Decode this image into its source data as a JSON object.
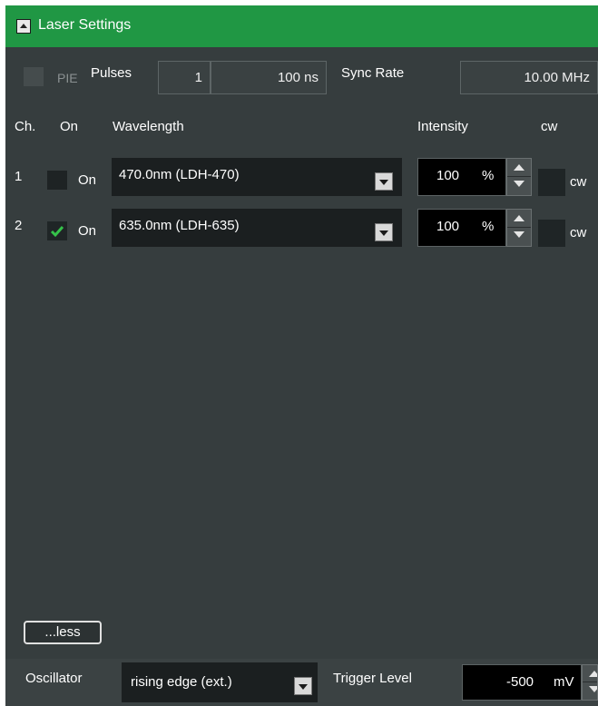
{
  "header": {
    "title": "Laser Settings"
  },
  "top": {
    "pie_label": "PIE",
    "pulses_label": "Pulses",
    "pulses_count": "1",
    "pulse_width": "100 ns",
    "sync_rate_label": "Sync Rate",
    "sync_rate_value": "10.00 MHz"
  },
  "columns": {
    "ch": "Ch.",
    "on": "On",
    "wavelength": "Wavelength",
    "intensity": "Intensity",
    "cw": "cw"
  },
  "channels": [
    {
      "ch": "1",
      "checked": false,
      "on_label": "On",
      "wavelength": "470.0nm (LDH-470)",
      "intensity": "100",
      "unit": "%",
      "cw": "cw"
    },
    {
      "ch": "2",
      "checked": true,
      "on_label": "On",
      "wavelength": "635.0nm (LDH-635)",
      "intensity": "100",
      "unit": "%",
      "cw": "cw"
    }
  ],
  "less_button": "...less",
  "bottom": {
    "oscillator_label": "Oscillator",
    "oscillator_value": "rising edge (ext.)",
    "trigger_label": "Trigger Level",
    "trigger_value": "-500",
    "trigger_unit": "mV"
  },
  "colors": {
    "header": "#209744",
    "panel": "#363d3e"
  }
}
